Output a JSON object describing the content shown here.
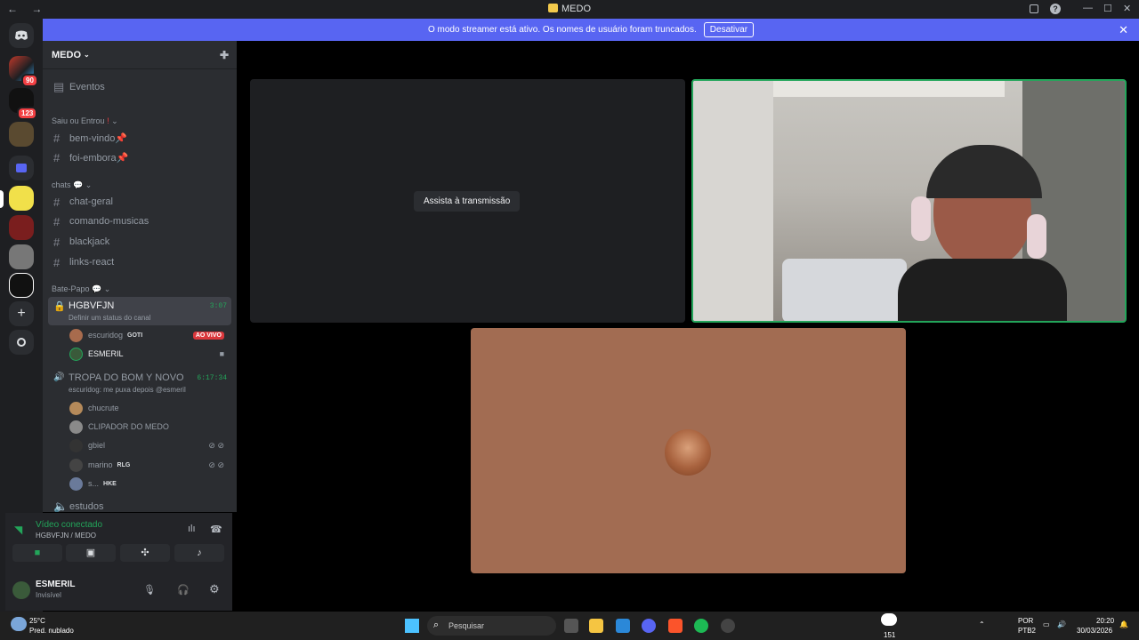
{
  "window": {
    "title": "MEDO",
    "back": "←",
    "forward": "→",
    "minimize": "—",
    "maximize": "☐",
    "close": "✕"
  },
  "banner": {
    "message": "O modo streamer está ativo. Os nomes de usuário foram truncados.",
    "button": "Desativar"
  },
  "guilds": {
    "badge1": "90",
    "badge2": "123"
  },
  "server": {
    "name": "MEDO",
    "events": "Eventos",
    "categories": [
      "Saiu ou Entrou",
      "chats",
      "Bate-Papo"
    ],
    "channels_top": [
      "bem-vindo📌",
      "foi-embora📌"
    ],
    "channels_chats": [
      "chat-geral",
      "comando-musicas",
      "blackjack",
      "links-react"
    ],
    "voice1": {
      "name": "HGBVFJN",
      "status": "Definir um status do canal",
      "time": "3:07"
    },
    "voice1_users": [
      {
        "name": "escuridog",
        "tag": "GOTI",
        "live": "AO VIVO"
      },
      {
        "name": "ESMERIL"
      }
    ],
    "voice2": {
      "name": "TROPA DO BOM Y NOVO",
      "status": "escuridog: me puxa depois @esmeril",
      "time": "6:17:34"
    },
    "voice2_users": [
      {
        "name": "chucrute"
      },
      {
        "name": "CLIPADOR DO MEDO"
      },
      {
        "name": "gbiel"
      },
      {
        "name": "marino",
        "tag": "RLG"
      },
      {
        "name": "s...",
        "tag": "HKE"
      }
    ],
    "voice3": "estudos"
  },
  "voice_panel": {
    "status": "Vídeo conectado",
    "channel": "HGBVFJN / MEDO"
  },
  "user_panel": {
    "name": "ESMERIL",
    "status": "Invisível"
  },
  "stage": {
    "watch_button": "Assista à transmissão"
  },
  "taskbar": {
    "weather_temp": "25°C",
    "weather_desc": "Pred. nublado",
    "search": "Pesquisar",
    "lang1": "POR",
    "lang2": "PTB2",
    "time": "20:20",
    "date": "30/03/2026",
    "chat_count": "151"
  },
  "colors": {
    "accent": "#5865f2",
    "online": "#23a55a",
    "live": "#da373c"
  }
}
